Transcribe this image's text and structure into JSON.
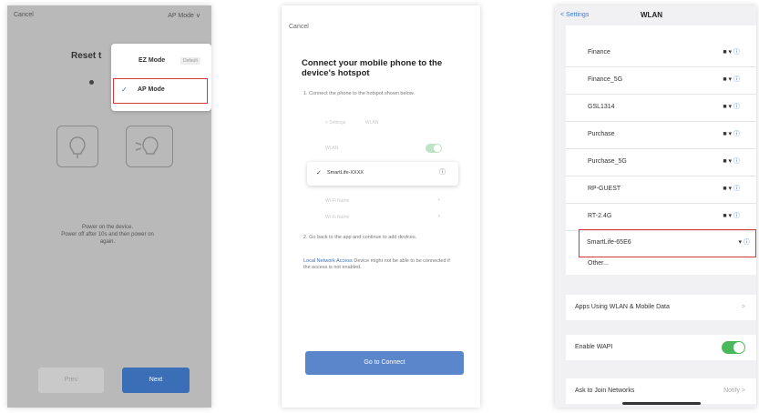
{
  "screen1": {
    "cancel": "Cancel",
    "mode_label": "AP Mode ∨",
    "title": "Reset t",
    "menu": [
      {
        "label": "EZ Mode",
        "badge": "Default"
      },
      {
        "label": "AP Mode",
        "check": "✓"
      }
    ],
    "description": [
      "Power on the device.",
      "Power off after 10s and then power on",
      "again."
    ],
    "prev_label": "Prev",
    "next_label": "Next"
  },
  "screen2": {
    "cancel": "Cancel",
    "heading": "Connect your mobile phone to the device's hotspot",
    "step1": "1. Connect the phone to the hotspot shown below.",
    "mock_rows": [
      "< Settings",
      "WLAN",
      "WLAN",
      "SmartLife-XXXX",
      "Wi-Fi Name",
      "Wi-Fi Name"
    ],
    "step2": "2. Go back to the app and continue to add devices.",
    "note_link": "Local Network Access",
    "note_text": "Device might not be able to be connected if the access is not enabled.",
    "connect_label": "Go to Connect"
  },
  "screen3": {
    "back": "< Settings",
    "title": "WLAN",
    "networks": [
      "Finance",
      "Finance_5G",
      "GSL1314",
      "Purchase",
      "Purchase_5G",
      "RP-GUEST",
      "RT-2.4G",
      "SmartLife-65E6"
    ],
    "other": "Other...",
    "apps_wlan": "Apps Using WLAN & Mobile Data",
    "enable_wapi": "Enable WAPI",
    "ask_join": "Ask to Join Networks",
    "ask_join_value": "Notify >",
    "chevron": ">",
    "icon_lock_wifi": "■ ▾",
    "icon_info": "ⓘ",
    "icon_wifi": "▾"
  }
}
